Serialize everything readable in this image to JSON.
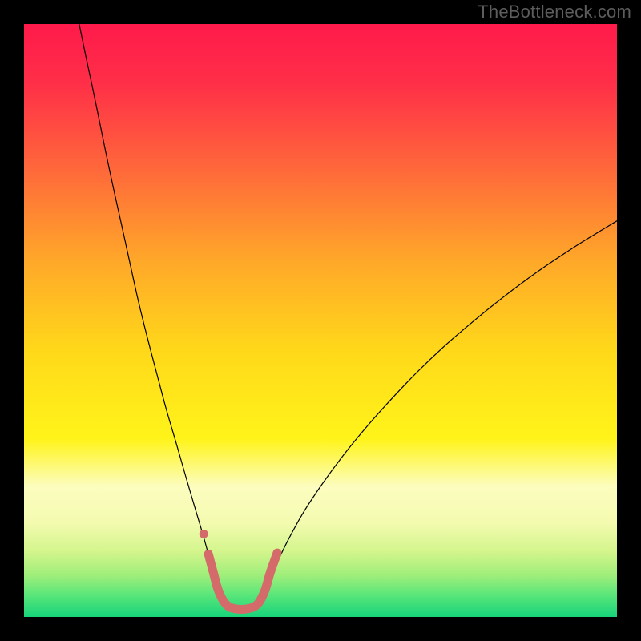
{
  "watermark": "TheBottleneck.com",
  "chart_data": {
    "type": "line",
    "title": "",
    "xlabel": "",
    "ylabel": "",
    "xlim": [
      0,
      100
    ],
    "ylim": [
      0,
      100
    ],
    "grid": false,
    "legend": false,
    "gradient_stops": [
      {
        "offset": 0.0,
        "color": "#ff1a4b"
      },
      {
        "offset": 0.1,
        "color": "#ff2f48"
      },
      {
        "offset": 0.25,
        "color": "#ff6a3a"
      },
      {
        "offset": 0.4,
        "color": "#ffa829"
      },
      {
        "offset": 0.55,
        "color": "#ffd81a"
      },
      {
        "offset": 0.7,
        "color": "#fff41a"
      },
      {
        "offset": 0.78,
        "color": "#fcfdbf"
      },
      {
        "offset": 0.84,
        "color": "#f4fbb0"
      },
      {
        "offset": 0.89,
        "color": "#d3f58c"
      },
      {
        "offset": 0.93,
        "color": "#9fee7a"
      },
      {
        "offset": 0.96,
        "color": "#5fe77a"
      },
      {
        "offset": 1.0,
        "color": "#17d47b"
      }
    ],
    "series": [
      {
        "name": "left-curve",
        "stroke": "#000000",
        "stroke_width": 1.2,
        "points": [
          {
            "x": 9.3,
            "y": 100.0
          },
          {
            "x": 10.2,
            "y": 95.6
          },
          {
            "x": 11.4,
            "y": 90.0
          },
          {
            "x": 12.6,
            "y": 84.2
          },
          {
            "x": 13.8,
            "y": 78.3
          },
          {
            "x": 15.1,
            "y": 72.2
          },
          {
            "x": 16.5,
            "y": 65.9
          },
          {
            "x": 17.9,
            "y": 59.5
          },
          {
            "x": 19.3,
            "y": 53.2
          },
          {
            "x": 20.8,
            "y": 47.1
          },
          {
            "x": 22.4,
            "y": 41.0
          },
          {
            "x": 24.0,
            "y": 35.0
          },
          {
            "x": 25.7,
            "y": 29.2
          },
          {
            "x": 27.3,
            "y": 23.6
          },
          {
            "x": 28.8,
            "y": 18.5
          },
          {
            "x": 30.2,
            "y": 13.8
          },
          {
            "x": 31.3,
            "y": 9.8
          },
          {
            "x": 32.2,
            "y": 6.6
          },
          {
            "x": 32.8,
            "y": 4.2
          }
        ]
      },
      {
        "name": "right-curve",
        "stroke": "#000000",
        "stroke_width": 1.2,
        "points": [
          {
            "x": 40.6,
            "y": 4.2
          },
          {
            "x": 41.5,
            "y": 6.4
          },
          {
            "x": 42.8,
            "y": 9.4
          },
          {
            "x": 44.6,
            "y": 13.1
          },
          {
            "x": 47.1,
            "y": 17.6
          },
          {
            "x": 50.2,
            "y": 22.3
          },
          {
            "x": 53.8,
            "y": 27.2
          },
          {
            "x": 57.8,
            "y": 32.1
          },
          {
            "x": 62.0,
            "y": 36.8
          },
          {
            "x": 66.3,
            "y": 41.3
          },
          {
            "x": 70.7,
            "y": 45.5
          },
          {
            "x": 75.1,
            "y": 49.3
          },
          {
            "x": 79.5,
            "y": 52.9
          },
          {
            "x": 83.8,
            "y": 56.2
          },
          {
            "x": 88.0,
            "y": 59.2
          },
          {
            "x": 92.2,
            "y": 62.0
          },
          {
            "x": 96.2,
            "y": 64.5
          },
          {
            "x": 100.0,
            "y": 66.8
          }
        ]
      },
      {
        "name": "bottom-bracket",
        "stroke": "#d46a6a",
        "stroke_width": 11,
        "linecap": "round",
        "points": [
          {
            "x": 31.1,
            "y": 10.6
          },
          {
            "x": 31.9,
            "y": 7.6
          },
          {
            "x": 32.8,
            "y": 4.4
          },
          {
            "x": 34.0,
            "y": 2.2
          },
          {
            "x": 35.5,
            "y": 1.4
          },
          {
            "x": 37.8,
            "y": 1.4
          },
          {
            "x": 39.4,
            "y": 2.2
          },
          {
            "x": 40.6,
            "y": 4.4
          },
          {
            "x": 41.5,
            "y": 7.4
          },
          {
            "x": 42.7,
            "y": 10.8
          }
        ]
      },
      {
        "name": "marker-dot",
        "type": "scatter",
        "fill": "#d46a6a",
        "radius": 5.5,
        "points": [
          {
            "x": 30.3,
            "y": 14.0
          }
        ]
      }
    ]
  }
}
